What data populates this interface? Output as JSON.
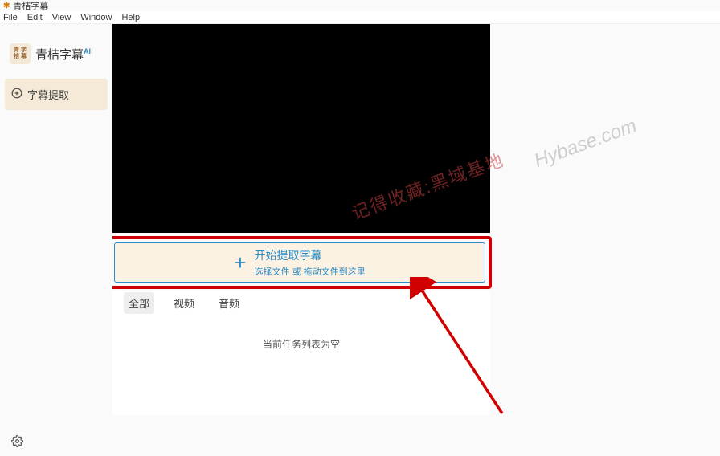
{
  "titlebar": {
    "app_name": "青桔字幕"
  },
  "menubar": {
    "file": "File",
    "edit": "Edit",
    "view": "View",
    "window": "Window",
    "help": "Help"
  },
  "sidebar": {
    "brand_logo_text1": "青 字",
    "brand_logo_text2": "桔 幕",
    "brand_name": "青桔字幕",
    "brand_ai": "AI",
    "nav_extract": "字幕提取"
  },
  "main": {
    "extract": {
      "title": "开始提取字幕",
      "subtitle": "选择文件 或 拖动文件到这里"
    },
    "tabs": {
      "all": "全部",
      "video": "视频",
      "audio": "音频"
    },
    "empty_text": "当前任务列表为空"
  },
  "watermark": {
    "text1": "记得收藏:黑域基地",
    "text2": "Hybase.com"
  }
}
